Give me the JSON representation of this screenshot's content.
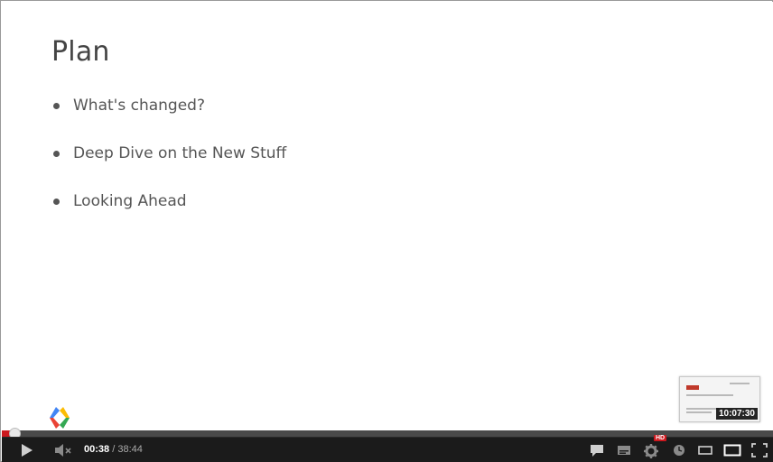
{
  "slide": {
    "title": "Plan",
    "bullets": [
      "What's changed?",
      "Deep Dive on the New Stuff",
      "Looking Ahead"
    ]
  },
  "logo": {
    "icon": "google-developers-icon"
  },
  "thumbnail": {
    "timestamp": "10:07:30"
  },
  "player": {
    "progress": 0.0165,
    "current_time": "00:38",
    "separator": "/",
    "duration": "38:44",
    "hd_badge": "HD",
    "colors": {
      "played": "#cc181e",
      "bar": "#1b1b1b",
      "track": "#4a4a4a"
    },
    "icons": [
      "play-icon",
      "mute-icon",
      "annotations-icon",
      "captions-icon",
      "settings-icon",
      "watch-later-icon",
      "small-player-icon",
      "large-player-icon",
      "fullscreen-icon"
    ]
  }
}
